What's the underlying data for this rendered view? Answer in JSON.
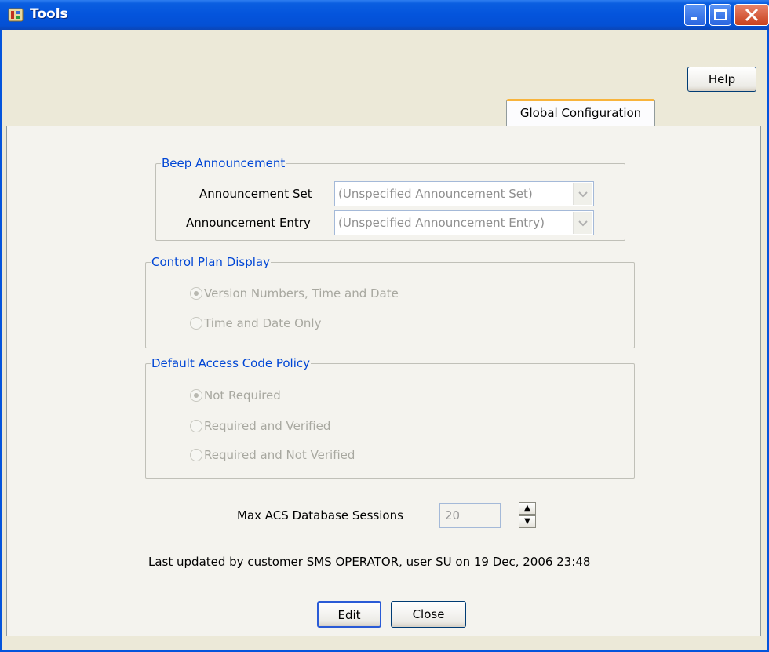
{
  "window": {
    "title": "Tools",
    "controls": [
      "minimize-icon",
      "maximize-icon",
      "close-icon"
    ]
  },
  "toolbar": {
    "help_label": "Help"
  },
  "tabs": [
    {
      "label": "Global Configuration",
      "active": true
    }
  ],
  "beep_announcement": {
    "legend": "Beep Announcement",
    "set_label": "Announcement Set",
    "set_value": "(Unspecified Announcement Set)",
    "entry_label": "Announcement Entry",
    "entry_value": "(Unspecified Announcement Entry)"
  },
  "control_plan_display": {
    "legend": "Control Plan Display",
    "options": [
      {
        "label": "Version Numbers, Time and Date",
        "selected": true
      },
      {
        "label": "Time and Date Only",
        "selected": false
      }
    ]
  },
  "default_access_code_policy": {
    "legend": "Default Access Code Policy",
    "options": [
      {
        "label": "Not Required",
        "selected": true
      },
      {
        "label": "Required and Verified",
        "selected": false
      },
      {
        "label": "Required and Not Verified",
        "selected": false
      }
    ]
  },
  "sessions": {
    "label": "Max ACS Database Sessions",
    "value": "20"
  },
  "status": {
    "last_updated": "Last updated by customer SMS OPERATOR, user SU on 19 Dec, 2006 23:48"
  },
  "footer": {
    "edit_label": "Edit",
    "close_label": "Close"
  },
  "colors": {
    "title_bar": "#0454dc",
    "legend_text": "#0046d5",
    "tab_accent": "#f8b43c",
    "window_bg": "#ece9d8"
  }
}
